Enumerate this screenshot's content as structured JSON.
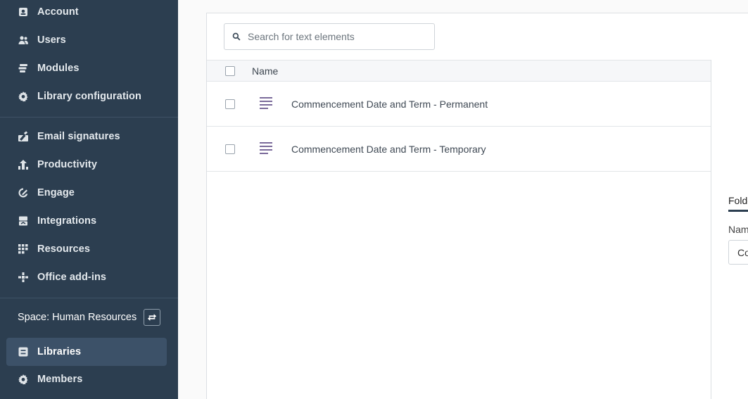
{
  "sidebar": {
    "items_top": [
      {
        "label": "Account",
        "icon": "account-icon"
      },
      {
        "label": "Users",
        "icon": "users-icon"
      },
      {
        "label": "Modules",
        "icon": "modules-icon"
      },
      {
        "label": "Library configuration",
        "icon": "gear-icon"
      }
    ],
    "items_mid": [
      {
        "label": "Email signatures",
        "icon": "signature-icon"
      },
      {
        "label": "Productivity",
        "icon": "productivity-icon"
      },
      {
        "label": "Engage",
        "icon": "engage-icon"
      },
      {
        "label": "Integrations",
        "icon": "integrations-icon"
      },
      {
        "label": "Resources",
        "icon": "grid-icon"
      },
      {
        "label": "Office add-ins",
        "icon": "add-ins-icon"
      }
    ],
    "space_label": "Space: Human Resources",
    "items_bottom": [
      {
        "label": "Libraries",
        "icon": "library-icon",
        "active": true
      },
      {
        "label": "Members",
        "icon": "gear-icon"
      }
    ],
    "colors": {
      "background": "#2c3e50",
      "active": "#3c5168"
    }
  },
  "main": {
    "search": {
      "placeholder": "Search for text elements",
      "value": ""
    },
    "table": {
      "columns": [
        "Name"
      ],
      "rows": [
        {
          "name": "Commencement Date and Term - Permanent"
        },
        {
          "name": "Commencement Date and Term - Temporary"
        }
      ]
    },
    "detail": {
      "tab_label": "Folde",
      "field_label": "Nam",
      "field_value": "Co"
    }
  }
}
